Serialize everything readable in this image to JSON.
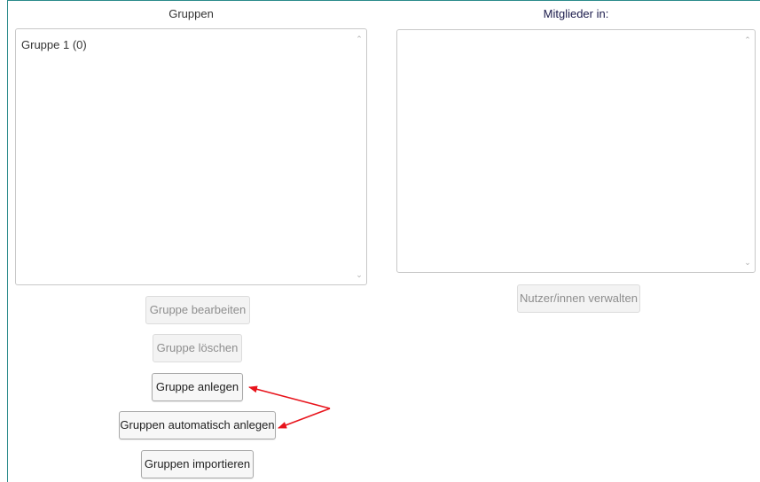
{
  "groups_panel": {
    "title": "Gruppen",
    "items": [
      {
        "label": "Gruppe 1 (0)"
      }
    ],
    "buttons": {
      "edit": "Gruppe bearbeiten",
      "delete": "Gruppe löschen",
      "create": "Gruppe anlegen",
      "auto_create": "Gruppen automatisch anlegen",
      "import": "Gruppen importieren"
    }
  },
  "members_panel": {
    "title": "Mitglieder in:",
    "items": [],
    "buttons": {
      "manage_users": "Nutzer/innen verwalten"
    }
  },
  "annotation": {
    "arrow_color": "#e8141c"
  },
  "colors": {
    "frame_border": "#2a8a8a",
    "disabled_text": "#8e8e8e"
  }
}
